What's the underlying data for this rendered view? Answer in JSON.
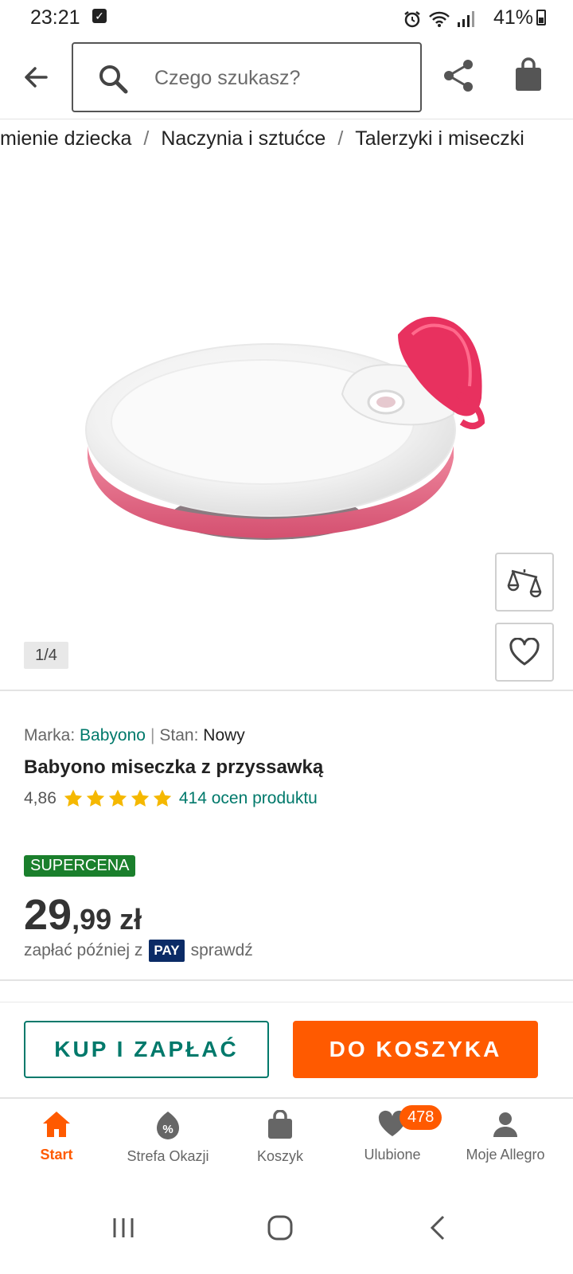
{
  "status_bar": {
    "time": "23:21",
    "battery": "41%"
  },
  "header": {
    "search_placeholder": "Czego szukasz?"
  },
  "breadcrumb": [
    "mienie dziecka",
    "Naczynia i sztućce",
    "Talerzyki i miseczki"
  ],
  "gallery": {
    "counter": "1/4"
  },
  "product": {
    "brand_label": "Marka:",
    "brand": "Babyono",
    "condition_label": "Stan:",
    "condition": "Nowy",
    "title": "Babyono miseczka z przyssawką",
    "rating": "4,86",
    "rating_stars": 5,
    "reviews": "414 ocen produktu",
    "badge": "SUPERCENA",
    "price_int": "29",
    "price_rest": ",99 zł",
    "pay_prefix": "zapłać później z",
    "pay_logo": "PAY",
    "pay_suffix": "sprawdź"
  },
  "actions": {
    "buy_label": "KUP I ZAPŁAĆ",
    "cart_label": "DO KOSZYKA"
  },
  "bottom_nav": {
    "items": [
      {
        "label": "Start",
        "icon": "home-icon"
      },
      {
        "label": "Strefa Okazji",
        "icon": "deals-icon"
      },
      {
        "label": "Koszyk",
        "icon": "bag-icon"
      },
      {
        "label": "Ulubione",
        "icon": "heart-icon",
        "badge": "478"
      },
      {
        "label": "Moje Allegro",
        "icon": "user-icon"
      }
    ]
  },
  "colors": {
    "accent": "#ff5a00",
    "teal": "#00796b",
    "badge_green": "#1a7f2c",
    "star": "#f5b800"
  }
}
